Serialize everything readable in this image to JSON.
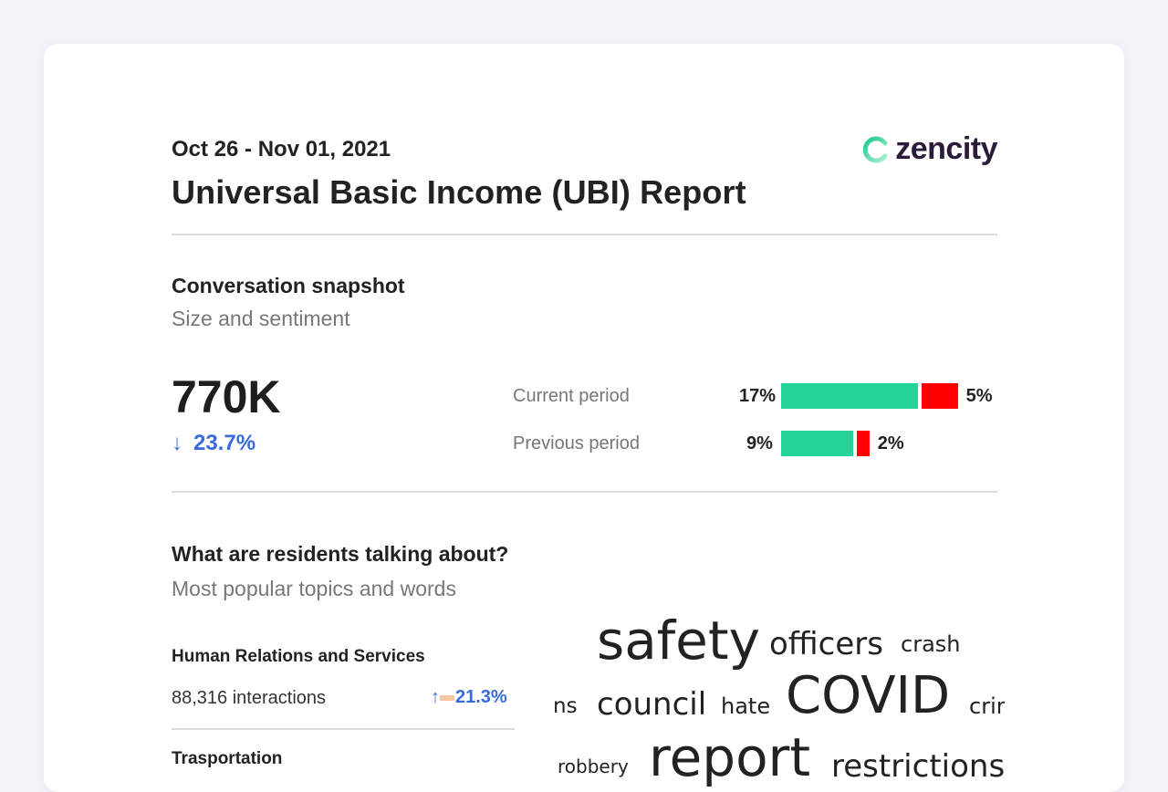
{
  "header": {
    "date_range": "Oct 26 - Nov 01, 2021",
    "title": "Universal Basic Income (UBI) Report",
    "logo_text": "zencity"
  },
  "snapshot": {
    "title": "Conversation snapshot",
    "subtitle": "Size and sentiment",
    "total": "770K",
    "change": "23.7%",
    "change_direction": "down",
    "periods": [
      {
        "label": "Current period",
        "positive_pct": "17%",
        "negative_pct": "5%",
        "positive": 17,
        "negative": 5
      },
      {
        "label": "Previous period",
        "positive_pct": "9%",
        "negative_pct": "2%",
        "positive": 9,
        "negative": 2
      }
    ],
    "colors": {
      "positive": "#27d497",
      "negative": "#ff0000",
      "change": "#3a6ae0"
    }
  },
  "topics": {
    "title": "What are residents talking about?",
    "subtitle": "Most popular topics and words",
    "items": [
      {
        "name": "Human Relations and Services",
        "interactions": "88,316 interactions",
        "change": "21.3%",
        "change_direction": "up"
      },
      {
        "name": "Trasportation"
      }
    ]
  },
  "word_cloud": {
    "words": [
      "safety",
      "officers",
      "crash",
      "ns",
      "council",
      "hate",
      "COVID",
      "crim",
      "robbery",
      "report",
      "restrictions"
    ]
  }
}
